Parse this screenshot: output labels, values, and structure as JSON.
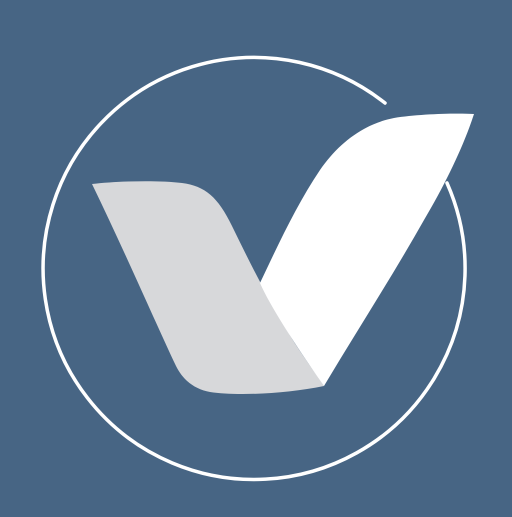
{
  "icon": {
    "name": "checkmark-v-logo-icon",
    "colors": {
      "background": "#476584",
      "ring": "#FFFFFF",
      "left_stroke": "#D7D8DA",
      "right_stroke": "#FFFFFF"
    }
  }
}
